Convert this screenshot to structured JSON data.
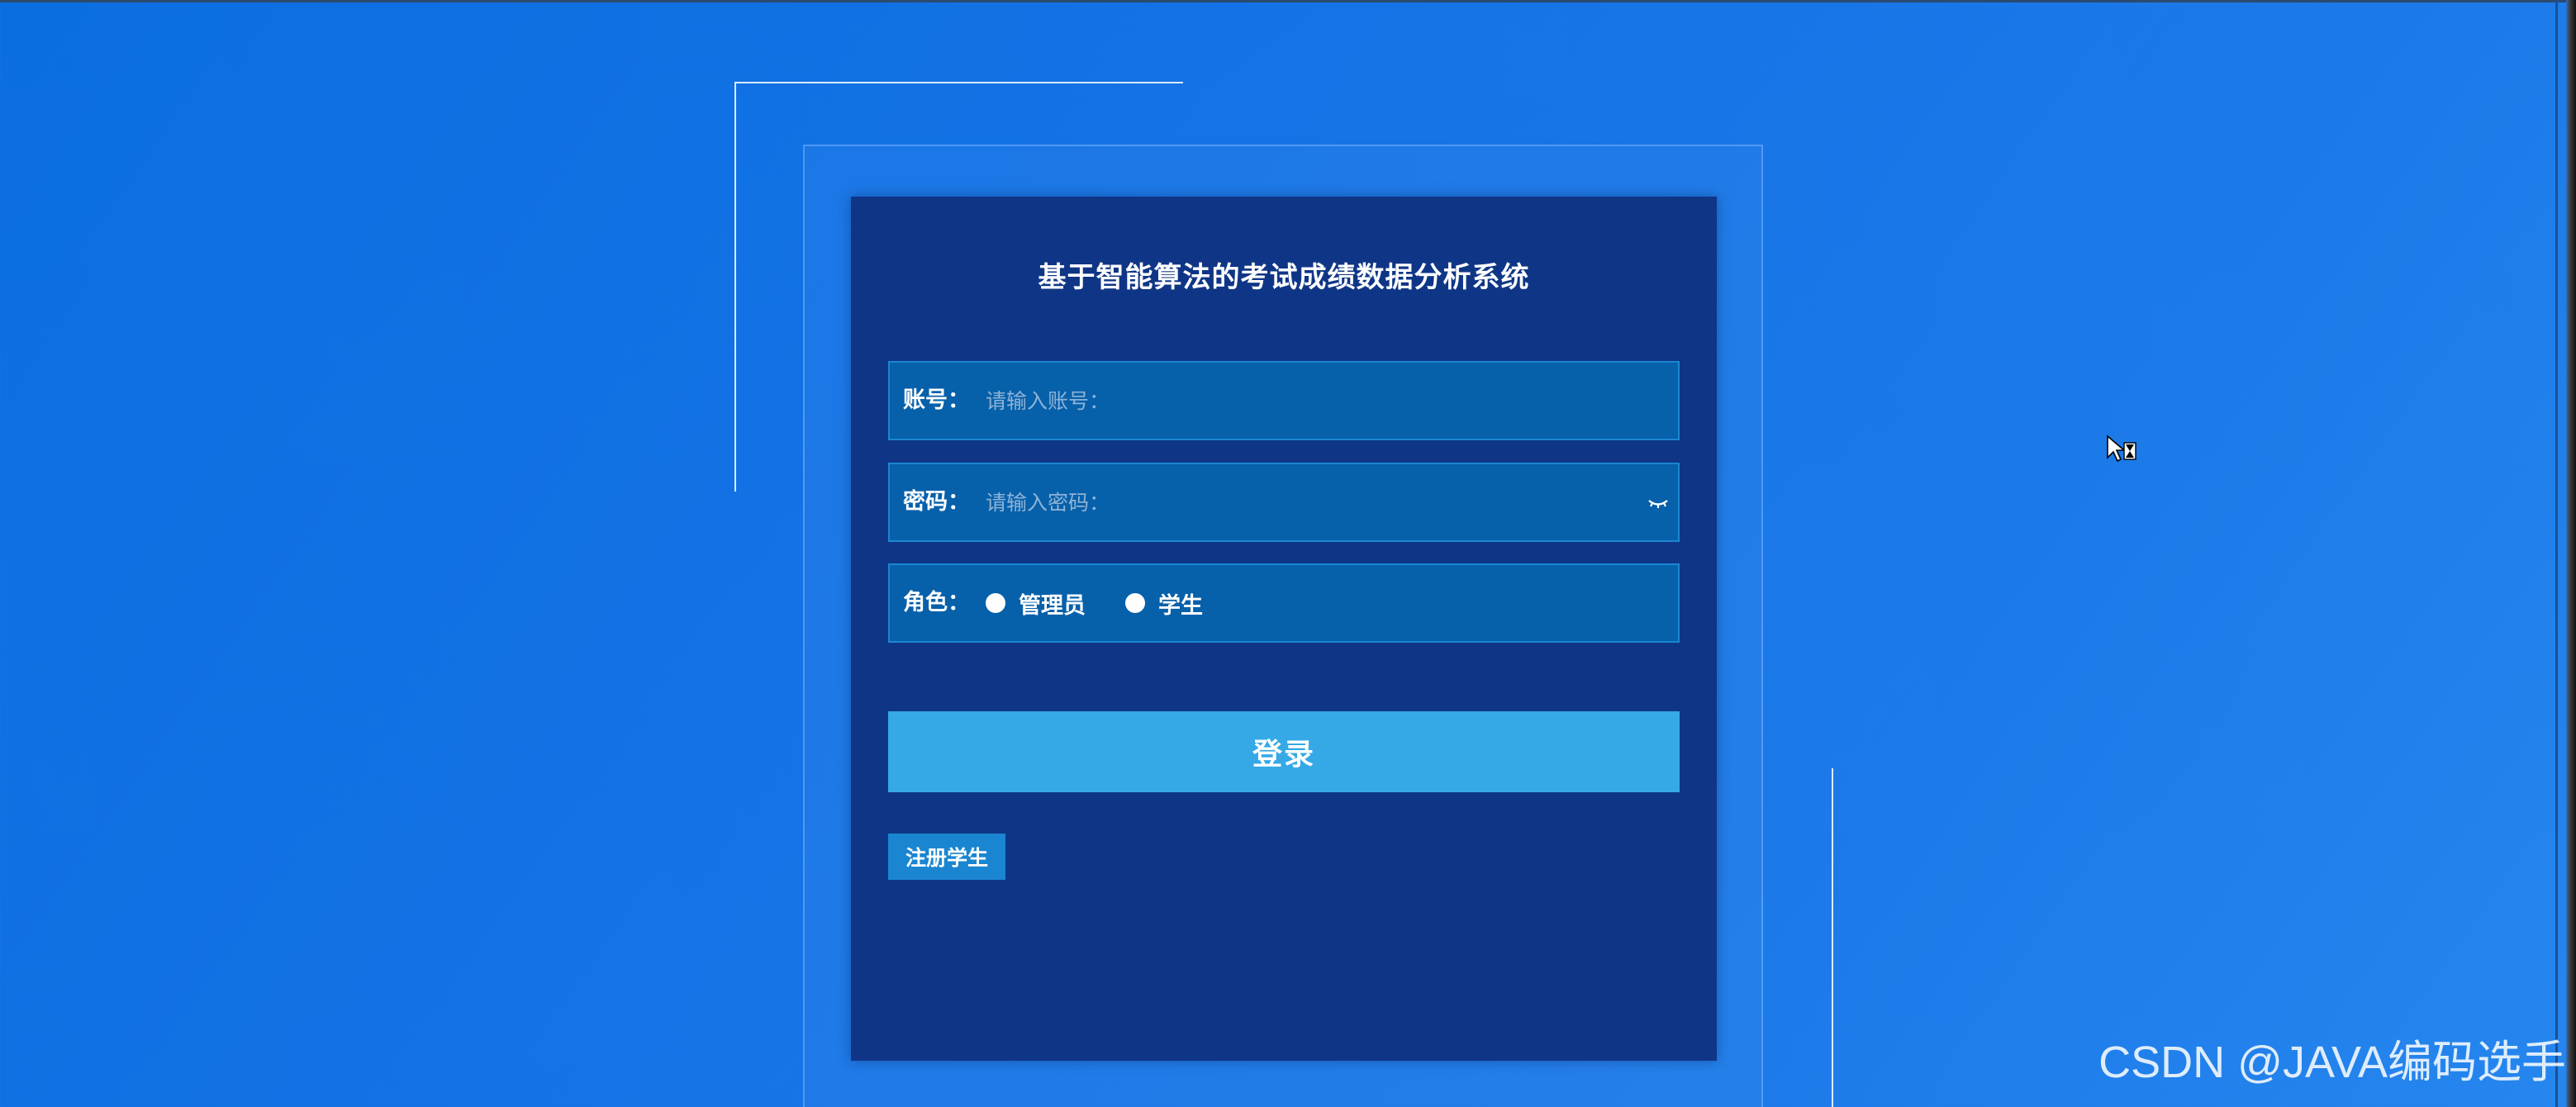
{
  "login": {
    "title": "基于智能算法的考试成绩数据分析系统",
    "account": {
      "label": "账号：",
      "placeholder": "请输入账号：",
      "value": ""
    },
    "password": {
      "label": "密码：",
      "placeholder": "请输入密码：",
      "value": "",
      "toggle_icon": "eye-closed-icon"
    },
    "role": {
      "label": "角色：",
      "options": [
        "管理员",
        "学生"
      ]
    },
    "login_button": "登录",
    "register_button": "注册学生"
  },
  "watermark": "CSDN @JAVA编码选手",
  "colors": {
    "card_bg": "#0f3686",
    "field_bg": "#0760aa",
    "field_border": "#1c86d2",
    "login_button_bg": "#35a9e6",
    "register_button_bg": "#1a86d1"
  }
}
